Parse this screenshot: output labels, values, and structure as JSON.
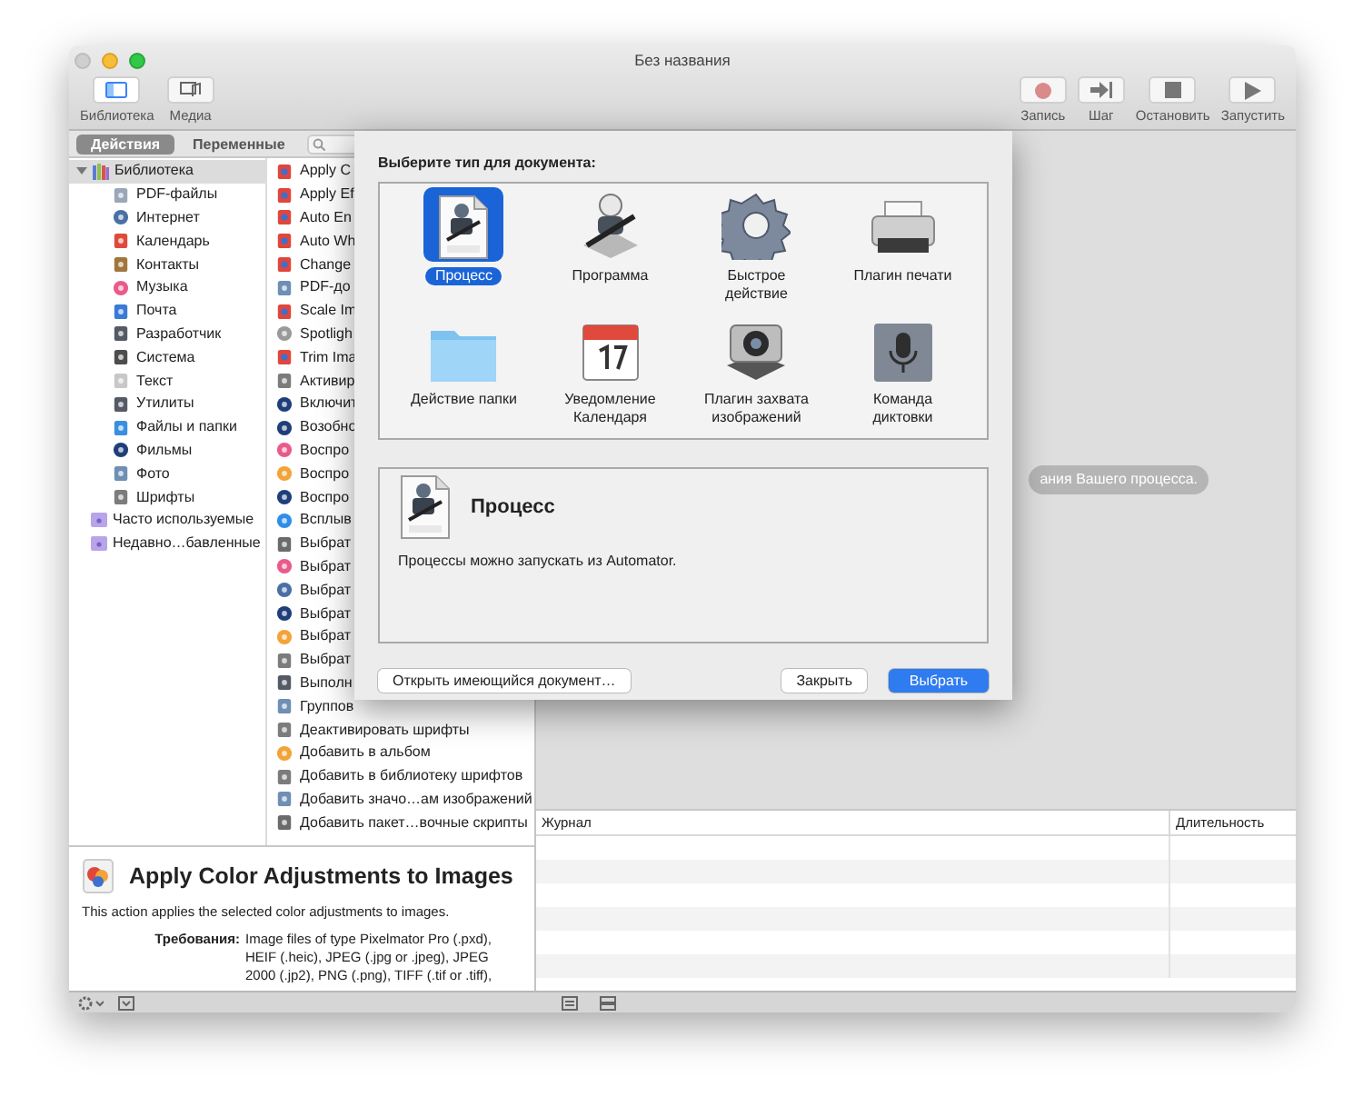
{
  "window": {
    "title": "Без названия"
  },
  "toolbar": {
    "left": [
      {
        "label": "Библиотека",
        "kind": "library",
        "selected": true
      },
      {
        "label": "Медиа",
        "kind": "media",
        "selected": false
      }
    ],
    "right": [
      {
        "label": "Запись",
        "kind": "record"
      },
      {
        "label": "Шаг",
        "kind": "step"
      },
      {
        "label": "Остановить",
        "kind": "stop"
      },
      {
        "label": "Запустить",
        "kind": "run"
      }
    ]
  },
  "tabs": [
    {
      "label": "Действия",
      "selected": true
    },
    {
      "label": "Переменные",
      "selected": false
    }
  ],
  "library": {
    "label": "Библиотека",
    "expanded": true,
    "selected": true,
    "children": [
      {
        "label": "PDF-файлы",
        "kind": "pdf",
        "selected": false
      },
      {
        "label": "Интернет",
        "kind": "globe",
        "selected": false
      },
      {
        "label": "Календарь",
        "kind": "calendar",
        "selected": false
      },
      {
        "label": "Контакты",
        "kind": "contacts",
        "selected": false
      },
      {
        "label": "Музыка",
        "kind": "music",
        "selected": false
      },
      {
        "label": "Почта",
        "kind": "mail",
        "selected": false
      },
      {
        "label": "Разработчик",
        "kind": "tools",
        "selected": false
      },
      {
        "label": "Система",
        "kind": "system",
        "selected": false
      },
      {
        "label": "Текст",
        "kind": "text",
        "selected": false
      },
      {
        "label": "Утилиты",
        "kind": "tools",
        "selected": false
      },
      {
        "label": "Файлы и папки",
        "kind": "finder",
        "selected": false
      },
      {
        "label": "Фильмы",
        "kind": "quicktime",
        "selected": false
      },
      {
        "label": "Фото",
        "kind": "preview",
        "selected": false
      },
      {
        "label": "Шрифты",
        "kind": "fonts",
        "selected": false
      }
    ]
  },
  "smart_folders": [
    {
      "label": "Часто используемые",
      "selected": false
    },
    {
      "label": "Недавно…бавленные",
      "selected": false
    }
  ],
  "actions": [
    {
      "label": "Apply C",
      "kind": "pixelmator"
    },
    {
      "label": "Apply Ef",
      "kind": "pixelmator"
    },
    {
      "label": "Auto En",
      "kind": "pixelmator"
    },
    {
      "label": "Auto Wh",
      "kind": "pixelmator"
    },
    {
      "label": "Change",
      "kind": "pixelmator"
    },
    {
      "label": "PDF-до",
      "kind": "preview"
    },
    {
      "label": "Scale Im",
      "kind": "pixelmator"
    },
    {
      "label": "Spotligh",
      "kind": "spotlight"
    },
    {
      "label": "Trim Ima",
      "kind": "pixelmator"
    },
    {
      "label": "Активир",
      "kind": "fonts"
    },
    {
      "label": "Включит",
      "kind": "quicktime"
    },
    {
      "label": "Возобно",
      "kind": "quicktime"
    },
    {
      "label": "Воспро",
      "kind": "music"
    },
    {
      "label": "Воспро",
      "kind": "photos"
    },
    {
      "label": "Воспро",
      "kind": "quicktime"
    },
    {
      "label": "Всплыв",
      "kind": "safari"
    },
    {
      "label": "Выбрат",
      "kind": "automator"
    },
    {
      "label": "Выбрат",
      "kind": "music"
    },
    {
      "label": "Выбрат",
      "kind": "globe"
    },
    {
      "label": "Выбрат",
      "kind": "quicktime"
    },
    {
      "label": "Выбрат",
      "kind": "photos"
    },
    {
      "label": "Выбрат",
      "kind": "fonts"
    },
    {
      "label": "Выполн",
      "kind": "tools"
    },
    {
      "label": "Группов",
      "kind": "preview"
    },
    {
      "label": "Деактивировать шрифты",
      "kind": "fonts"
    },
    {
      "label": "Добавить в альбом",
      "kind": "photos"
    },
    {
      "label": "Добавить в библиотеку шрифтов",
      "kind": "fonts"
    },
    {
      "label": "Добавить значо…ам изображений",
      "kind": "preview"
    },
    {
      "label": "Добавить пакет…вочные скрипты",
      "kind": "automator"
    }
  ],
  "workflow_hint": "ания Вашего процесса.",
  "description": {
    "title": "Apply Color Adjustments to Images",
    "text": "This action applies the selected color adjustments to images.",
    "requirements_label": "Требования:",
    "requirements": "Image files of type Pixelmator Pro (.pxd), HEIF (.heic), JPEG (.jpg or .jpeg), JPEG 2000 (.jp2), PNG (.png), TIFF (.tif or .tiff),"
  },
  "log": {
    "columns": [
      "Журнал",
      "Длительность"
    ]
  },
  "dialog": {
    "title": "Выберите тип для документа:",
    "types": [
      {
        "label": "Процесс",
        "kind": "workflow",
        "selected": true
      },
      {
        "label": "Программа",
        "kind": "app",
        "selected": false
      },
      {
        "label": "Быстрое\nдействие",
        "kind": "gear",
        "selected": false
      },
      {
        "label": "Плагин печати",
        "kind": "printer",
        "selected": false
      },
      {
        "label": "Действие папки",
        "kind": "folder",
        "selected": false
      },
      {
        "label": "Уведомление\nКалендаря",
        "kind": "calendar",
        "selected": false
      },
      {
        "label": "Плагин захвата\nизображений",
        "kind": "camera",
        "selected": false
      },
      {
        "label": "Команда\nдиктовки",
        "kind": "mic",
        "selected": false
      }
    ],
    "detail": {
      "title": "Процесс",
      "text": "Процессы можно запускать из Automator."
    },
    "buttons": [
      {
        "label": "Открыть имеющийся документ…",
        "kind": "secondary"
      },
      {
        "label": "Закрыть",
        "kind": "secondary"
      },
      {
        "label": "Выбрать",
        "kind": "default"
      }
    ]
  }
}
